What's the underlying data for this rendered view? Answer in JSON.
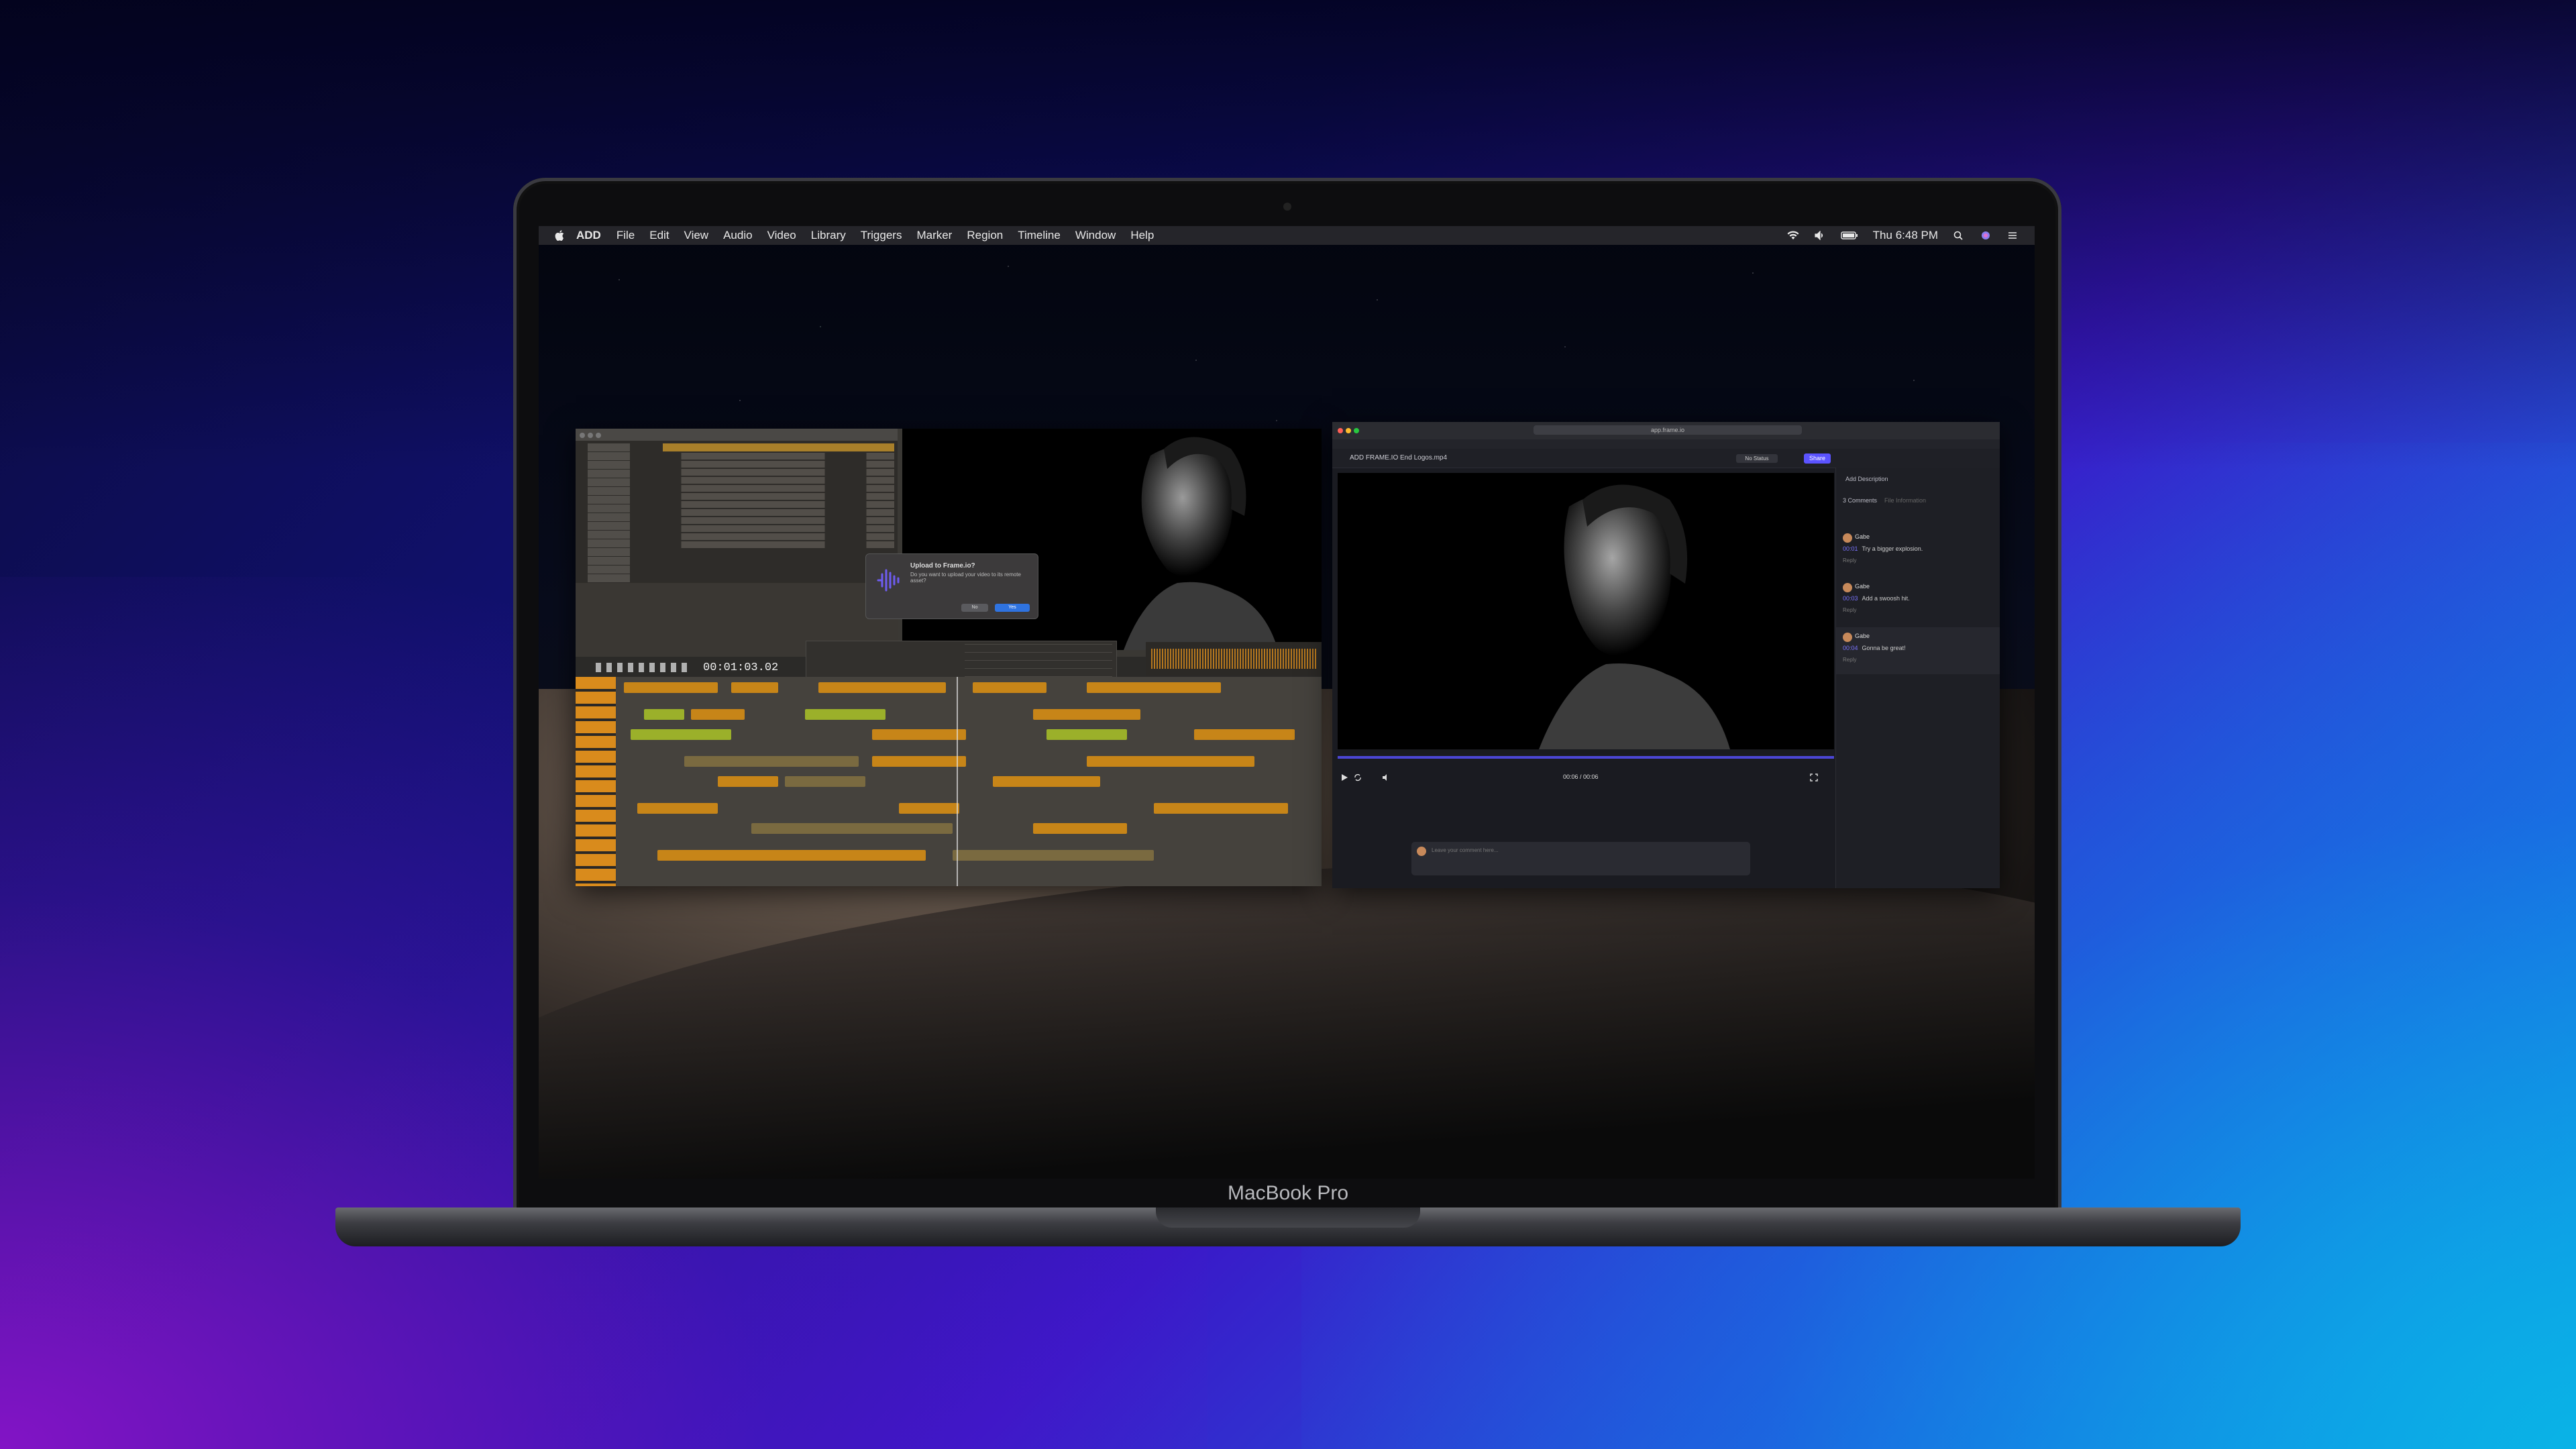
{
  "device": {
    "brand": "MacBook Pro"
  },
  "menubar": {
    "app_name": "ADD",
    "items": [
      "File",
      "Edit",
      "View",
      "Audio",
      "Video",
      "Library",
      "Triggers",
      "Marker",
      "Region",
      "Timeline",
      "Window",
      "Help"
    ],
    "clock": "Thu 6:48 PM",
    "icons": [
      "wifi-icon",
      "volume-icon",
      "battery-icon",
      "search-icon",
      "siri-icon",
      "control-center-icon"
    ]
  },
  "daw": {
    "timecode": "00:01:03.02",
    "dialog": {
      "title": "Upload to Frame.io?",
      "message": "Do you want to upload your video to its remote asset?",
      "no_label": "No",
      "yes_label": "Yes"
    }
  },
  "frameio": {
    "url": "app.frame.io",
    "asset_title": "ADD FRAME.IO End Logos.mp4",
    "status_label": "No Status",
    "share_label": "Share",
    "timecode": "00:06 / 00:06",
    "add_description": "Add Description",
    "comments_count": "3 Comments",
    "file_info": "File Information",
    "comment_placeholder": "Leave your comment here...",
    "comments": [
      {
        "author": "Gabe",
        "tc": "00:01",
        "text": "Try a bigger explosion.",
        "reply": "Reply"
      },
      {
        "author": "Gabe",
        "tc": "00:03",
        "text": "Add a swoosh hit.",
        "reply": "Reply"
      },
      {
        "author": "Gabe",
        "tc": "00:04",
        "text": "Gonna be great!",
        "reply": "Reply"
      }
    ]
  }
}
